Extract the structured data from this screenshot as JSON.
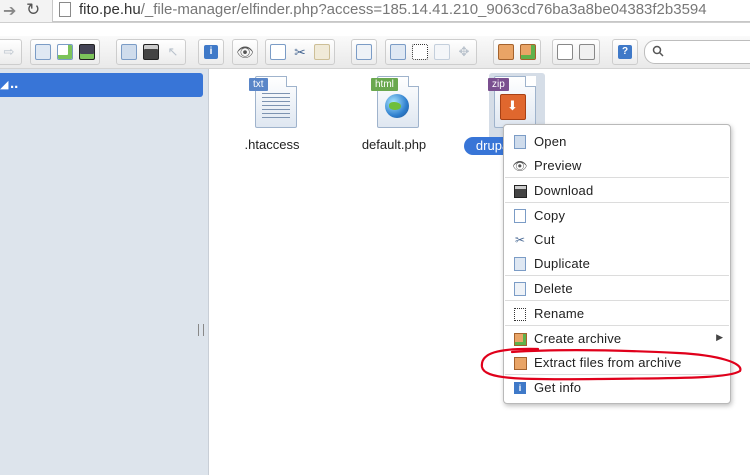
{
  "browser": {
    "url_host": "fito.pe.hu",
    "url_rest": "/_file-manager/elfinder.php?access=185.14.41.210_9063cd76ba3a8be04383f2b3594"
  },
  "toolbar": {
    "groups": [
      {
        "buttons": [
          {
            "icon": "arrow-right-icon",
            "enabled": false
          }
        ]
      },
      {
        "buttons": [
          {
            "icon": "new-folder-icon"
          },
          {
            "icon": "new-file-icon"
          },
          {
            "icon": "upload-icon"
          }
        ]
      },
      {
        "buttons": [
          {
            "icon": "open-icon"
          },
          {
            "icon": "save-icon"
          },
          {
            "icon": "select-icon",
            "enabled": false
          }
        ]
      },
      {
        "buttons": [
          {
            "icon": "info-icon"
          }
        ]
      },
      {
        "buttons": [
          {
            "icon": "preview-icon"
          }
        ]
      },
      {
        "buttons": [
          {
            "icon": "copy-icon"
          },
          {
            "icon": "cut-icon"
          },
          {
            "icon": "paste-icon",
            "enabled": false
          }
        ]
      },
      {
        "buttons": [
          {
            "icon": "delete-icon"
          }
        ]
      },
      {
        "buttons": [
          {
            "icon": "duplicate-icon"
          },
          {
            "icon": "rename-icon"
          },
          {
            "icon": "edit-icon",
            "enabled": false
          },
          {
            "icon": "resize-icon",
            "enabled": false
          }
        ]
      },
      {
        "buttons": [
          {
            "icon": "extract-icon"
          },
          {
            "icon": "archive-icon"
          }
        ]
      },
      {
        "buttons": [
          {
            "icon": "icons-view-icon"
          },
          {
            "icon": "list-view-icon"
          }
        ]
      },
      {
        "buttons": [
          {
            "icon": "help-icon"
          }
        ]
      }
    ]
  },
  "sidebar": {
    "root_label": ".."
  },
  "files": [
    {
      "name": ".htaccess",
      "type_tag": "txt",
      "tag_color": "#5a86c8"
    },
    {
      "name": "default.php",
      "type_tag": "html",
      "tag_color": "#6aa84f"
    },
    {
      "name": "drupal",
      "type_tag": "zip",
      "tag_color": "#7a4f8f",
      "selected": true
    }
  ],
  "context_menu": {
    "items": [
      {
        "label": "Open",
        "icon": "open-icon"
      },
      {
        "label": "Preview",
        "icon": "eye-icon"
      },
      {
        "label": "Download",
        "icon": "download-icon"
      },
      {
        "label": "Copy",
        "icon": "copy-icon"
      },
      {
        "label": "Cut",
        "icon": "cut-icon"
      },
      {
        "label": "Duplicate",
        "icon": "duplicate-icon"
      },
      {
        "label": "Delete",
        "icon": "delete-icon"
      },
      {
        "label": "Rename",
        "icon": "rename-icon"
      },
      {
        "label": "Create archive",
        "icon": "archive-icon",
        "has_submenu": true
      },
      {
        "label": "Extract files from archive",
        "icon": "extract-icon",
        "highlighted": true
      },
      {
        "label": "Get info",
        "icon": "info-icon"
      }
    ]
  },
  "colors": {
    "selection": "#3875d7",
    "annotation": "#e0001b"
  }
}
